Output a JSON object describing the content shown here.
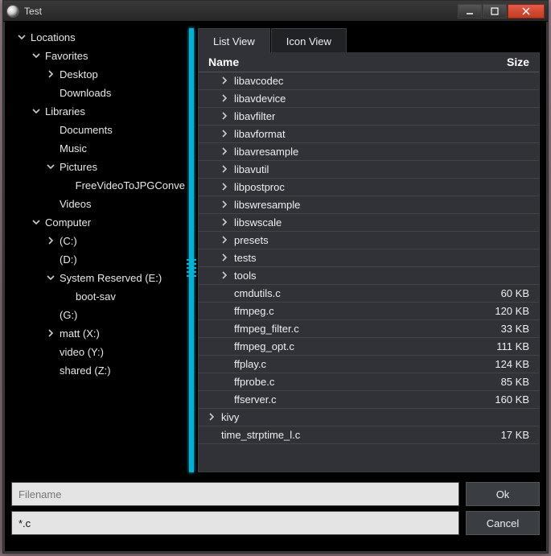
{
  "window": {
    "title": "Test"
  },
  "sidebar": {
    "root_label": "Locations",
    "groups": [
      {
        "label": "Favorites",
        "expanded": true,
        "items": [
          {
            "label": "Desktop",
            "has_children": true
          },
          {
            "label": "Downloads",
            "has_children": false
          }
        ]
      },
      {
        "label": "Libraries",
        "expanded": true,
        "items": [
          {
            "label": "Documents",
            "has_children": false
          },
          {
            "label": "Music",
            "has_children": false
          },
          {
            "label": "Pictures",
            "has_children": true,
            "expanded": true,
            "children": [
              {
                "label": "FreeVideoToJPGConve"
              }
            ]
          },
          {
            "label": "Videos",
            "has_children": false
          }
        ]
      },
      {
        "label": "Computer",
        "expanded": true,
        "items": [
          {
            "label": "(C:)",
            "has_children": true
          },
          {
            "label": "(D:)",
            "has_children": false
          },
          {
            "label": "System Reserved (E:)",
            "has_children": true,
            "expanded": true,
            "children": [
              {
                "label": "boot-sav"
              }
            ]
          },
          {
            "label": "(G:)",
            "has_children": false
          },
          {
            "label": "matt (X:)",
            "has_children": true
          },
          {
            "label": "video (Y:)",
            "has_children": false
          },
          {
            "label": "shared (Z:)",
            "has_children": false
          }
        ]
      }
    ]
  },
  "tabs": {
    "list_view": "List View",
    "icon_view": "Icon View",
    "active": 0
  },
  "columns": {
    "name": "Name",
    "size": "Size"
  },
  "files": [
    {
      "name": "libavcodec",
      "type": "dir"
    },
    {
      "name": "libavdevice",
      "type": "dir"
    },
    {
      "name": "libavfilter",
      "type": "dir"
    },
    {
      "name": "libavformat",
      "type": "dir"
    },
    {
      "name": "libavresample",
      "type": "dir"
    },
    {
      "name": "libavutil",
      "type": "dir"
    },
    {
      "name": "libpostproc",
      "type": "dir"
    },
    {
      "name": "libswresample",
      "type": "dir"
    },
    {
      "name": "libswscale",
      "type": "dir"
    },
    {
      "name": "presets",
      "type": "dir"
    },
    {
      "name": "tests",
      "type": "dir"
    },
    {
      "name": "tools",
      "type": "dir"
    },
    {
      "name": "cmdutils.c",
      "type": "file",
      "size": "60 KB"
    },
    {
      "name": "ffmpeg.c",
      "type": "file",
      "size": "120 KB"
    },
    {
      "name": "ffmpeg_filter.c",
      "type": "file",
      "size": "33 KB"
    },
    {
      "name": "ffmpeg_opt.c",
      "type": "file",
      "size": "111 KB"
    },
    {
      "name": "ffplay.c",
      "type": "file",
      "size": "124 KB"
    },
    {
      "name": "ffprobe.c",
      "type": "file",
      "size": "85 KB"
    },
    {
      "name": "ffserver.c",
      "type": "file",
      "size": "160 KB"
    },
    {
      "name": "kivy",
      "type": "dir",
      "level": 0
    },
    {
      "name": "time_strptime_l.c",
      "type": "file",
      "size": "17 KB",
      "level": 0
    }
  ],
  "inputs": {
    "filename_placeholder": "Filename",
    "filename_value": "",
    "filter_value": "*.c"
  },
  "buttons": {
    "ok": "Ok",
    "cancel": "Cancel"
  }
}
